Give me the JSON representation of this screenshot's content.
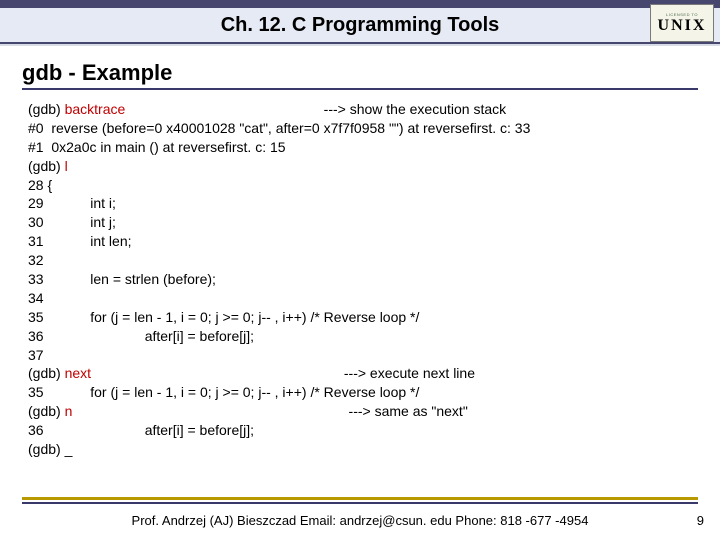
{
  "title": "Ch. 12. C Programming Tools",
  "badge": {
    "small": "LICENSED TO",
    "big": "UNIX"
  },
  "subtitle": "gdb - Example",
  "code": {
    "l1a": "(gdb) ",
    "l1cmd": "backtrace",
    "l1b": "                                                   ---> show the execution stack",
    "l2": "#0  reverse (before=0 x40001028 \"cat\", after=0 x7f7f0958 \"\") at reversefirst. c: 33",
    "l3": "#1  0x2a0c in main () at reversefirst. c: 15",
    "l4a": "(gdb) ",
    "l4cmd": "l",
    "l5": "28 {",
    "l6": "29            int i;",
    "l7": "30            int j;",
    "l8": "31            int len;",
    "l9": "32",
    "l10": "33            len = strlen (before);",
    "l11": "34",
    "l12": "35            for (j = len - 1, i = 0; j >= 0; j-- , i++) /* Reverse loop */",
    "l13": "36                          after[i] = before[j];",
    "l14": "37",
    "l15a": "(gdb) ",
    "l15cmd": "next",
    "l15b": "                                                                 ---> execute next line",
    "l16": "35            for (j = len - 1, i = 0; j >= 0; j-- , i++) /* Reverse loop */",
    "l17a": "(gdb) ",
    "l17cmd": "n",
    "l17b": "                                                                       ---> same as \"next\"",
    "l18": "36                          after[i] = before[j];",
    "l19": "(gdb) _"
  },
  "footer": "Prof. Andrzej (AJ) Bieszczad Email: andrzej@csun. edu Phone: 818 -677 -4954",
  "page": "9"
}
